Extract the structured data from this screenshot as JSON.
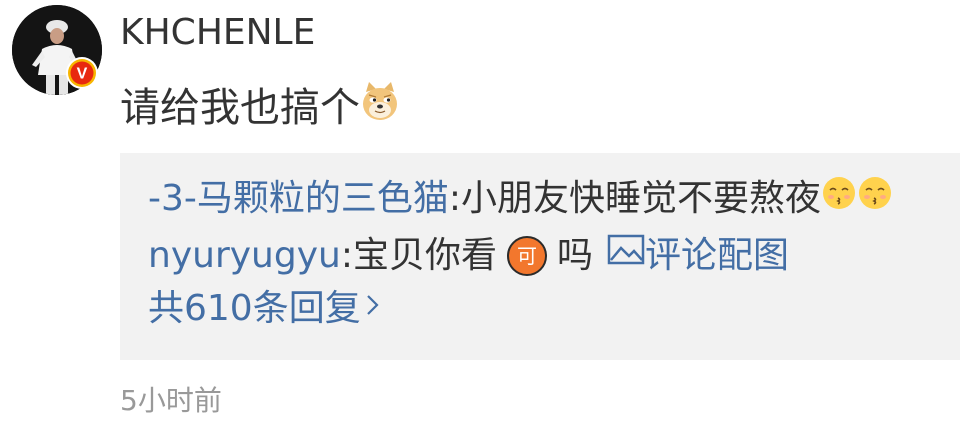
{
  "comment": {
    "username": "KHCHENLE",
    "verified_badge_label": "V",
    "text": "请给我也搞个",
    "text_emoji": "doge-emoji",
    "timestamp": "5小时前"
  },
  "replies": [
    {
      "author": "-3-马颗粒的三色猫",
      "separator": ":",
      "text": "小朋友快睡觉不要熬夜",
      "emojis": [
        "kiss-emoji",
        "kiss-emoji"
      ]
    },
    {
      "author": "nyuryugyu",
      "separator": ":",
      "text": "宝贝你看",
      "badge": "可",
      "text_after": "吗",
      "image_link_label": "评论配图"
    }
  ],
  "more_replies_label": "共610条回复",
  "colors": {
    "link": "#436ea5",
    "text": "#333333",
    "muted": "#999999",
    "reply_bg": "#f2f2f2",
    "verified": "#e8290f",
    "badge_orange": "#f2772d"
  }
}
